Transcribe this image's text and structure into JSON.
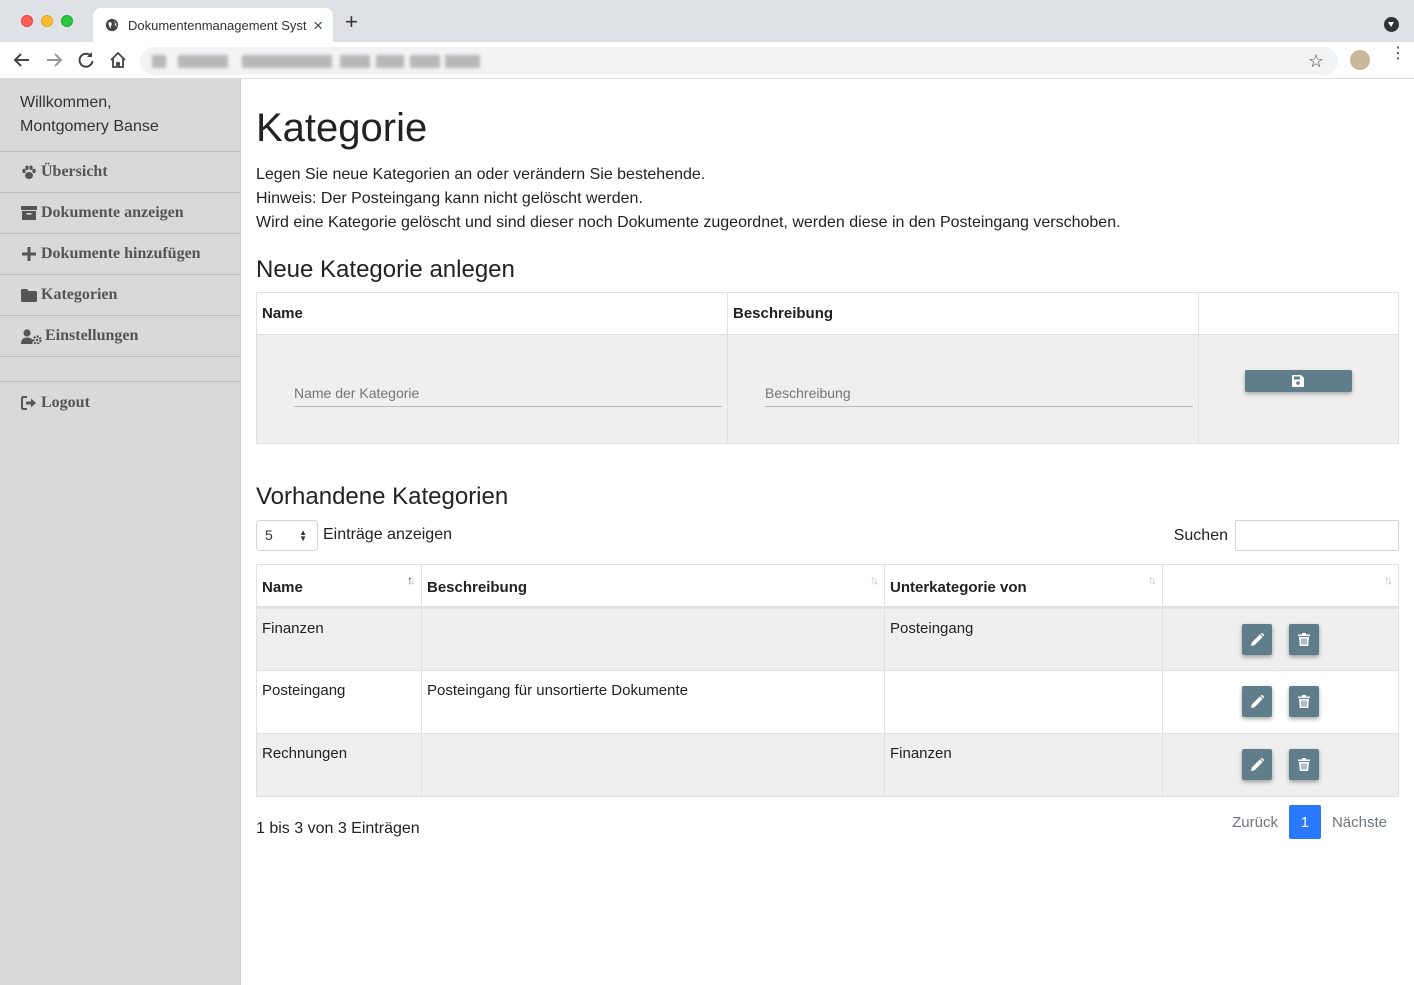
{
  "browser": {
    "tab_title": "Dokumentenmanagement Syst",
    "close_glyph": "×",
    "new_tab_glyph": "+",
    "star_glyph": "☆",
    "menu_glyph": "⋮"
  },
  "sidebar": {
    "welcome_line1": "Willkommen,",
    "welcome_line2": "Montgomery Banse",
    "items": [
      {
        "label": "Übersicht",
        "icon": "paw-icon"
      },
      {
        "label": "Dokumente anzeigen",
        "icon": "archive-icon"
      },
      {
        "label": "Dokumente hinzufügen",
        "icon": "plus-icon"
      },
      {
        "label": "Kategorien",
        "icon": "folder-icon"
      },
      {
        "label": "Einstellungen",
        "icon": "user-cog-icon"
      }
    ],
    "logout": {
      "label": "Logout",
      "icon": "sign-out-icon"
    }
  },
  "page": {
    "title": "Kategorie",
    "intro": [
      "Legen Sie neue Kategorien an oder verändern Sie bestehende.",
      "Hinweis: Der Posteingang kann nicht gelöscht werden.",
      "Wird eine Kategorie gelöscht und sind dieser noch Dokumente zugeordnet, werden diese in den Posteingang verschoben."
    ]
  },
  "new_category": {
    "heading": "Neue Kategorie anlegen",
    "col_name": "Name",
    "col_description": "Beschreibung",
    "name_placeholder": "Name der Kategorie",
    "description_placeholder": "Beschreibung"
  },
  "existing": {
    "heading": "Vorhandene Kategorien",
    "length_value": "5",
    "length_label": "Einträge anzeigen",
    "search_label": "Suchen",
    "columns": [
      "Name",
      "Beschreibung",
      "Unterkategorie von",
      ""
    ],
    "rows": [
      {
        "name": "Finanzen",
        "description": "",
        "parent": "Posteingang"
      },
      {
        "name": "Posteingang",
        "description": "Posteingang für unsortierte Dokumente",
        "parent": ""
      },
      {
        "name": "Rechnungen",
        "description": "",
        "parent": "Finanzen"
      }
    ],
    "info": "1 bis 3 von 3 Einträgen",
    "pager": {
      "prev": "Zurück",
      "current": "1",
      "next": "Nächste"
    }
  },
  "colors": {
    "accent_button": "#607d8b",
    "pager_active": "#2979ff",
    "sidebar_bg": "#d9d9d9"
  }
}
